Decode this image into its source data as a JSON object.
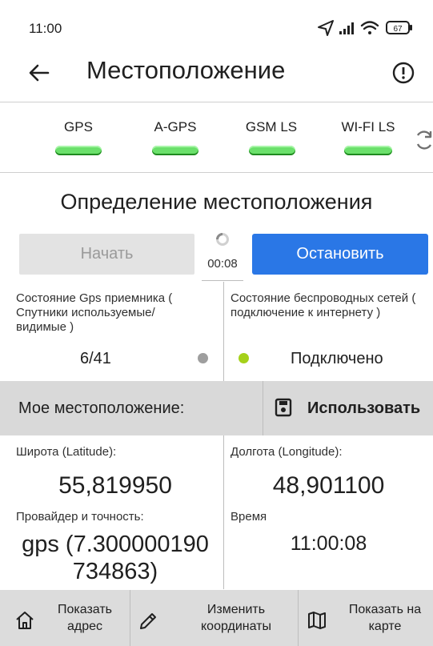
{
  "status_bar": {
    "time": "11:00",
    "battery": "67"
  },
  "app_bar": {
    "title": "Местоположение",
    "icons": {
      "back": "arrow-left",
      "info": "exclamation-circle"
    }
  },
  "indicators": [
    {
      "label": "GPS",
      "color": "#6be06b"
    },
    {
      "label": "A-GPS",
      "color": "#6be06b"
    },
    {
      "label": "GSM LS",
      "color": "#6be06b"
    },
    {
      "label": "WI-FI LS",
      "color": "#6be06b"
    }
  ],
  "section": {
    "heading": "Определение местоположения"
  },
  "controls": {
    "start_label": "Начать",
    "stop_label": "Остановить",
    "timer": "00:08",
    "colors": {
      "stop": "#2a77e6",
      "start_disabled": "#e3e3e3"
    }
  },
  "gps_status": {
    "label": "Состояние Gps приемника ( Спутники используемые/ видимые )",
    "value": "6/41",
    "dot_color": "#9e9e9e"
  },
  "wifi_status": {
    "label": "Состояние беспроводных сетей ( подключение к интернету )",
    "value": "Подключено",
    "dot_color": "#a5d11a"
  },
  "location_bar": {
    "label": "Мое местоположение:",
    "use_label": "Использовать"
  },
  "coordinates": {
    "lat_label": "Широта (Latitude):",
    "lat_value": "55,819950",
    "lon_label": "Долгота (Longitude):",
    "lon_value": "48,901100",
    "provider_label": "Провайдер и точность:",
    "provider_value": "gps (7.300000190 734863)",
    "time_label": "Время",
    "time_value": "11:00:08"
  },
  "bottom_actions": [
    {
      "label": "Показать адрес",
      "icon": "home"
    },
    {
      "label": "Изменить координаты",
      "icon": "pencil"
    },
    {
      "label": "Показать на карте",
      "icon": "map"
    }
  ]
}
